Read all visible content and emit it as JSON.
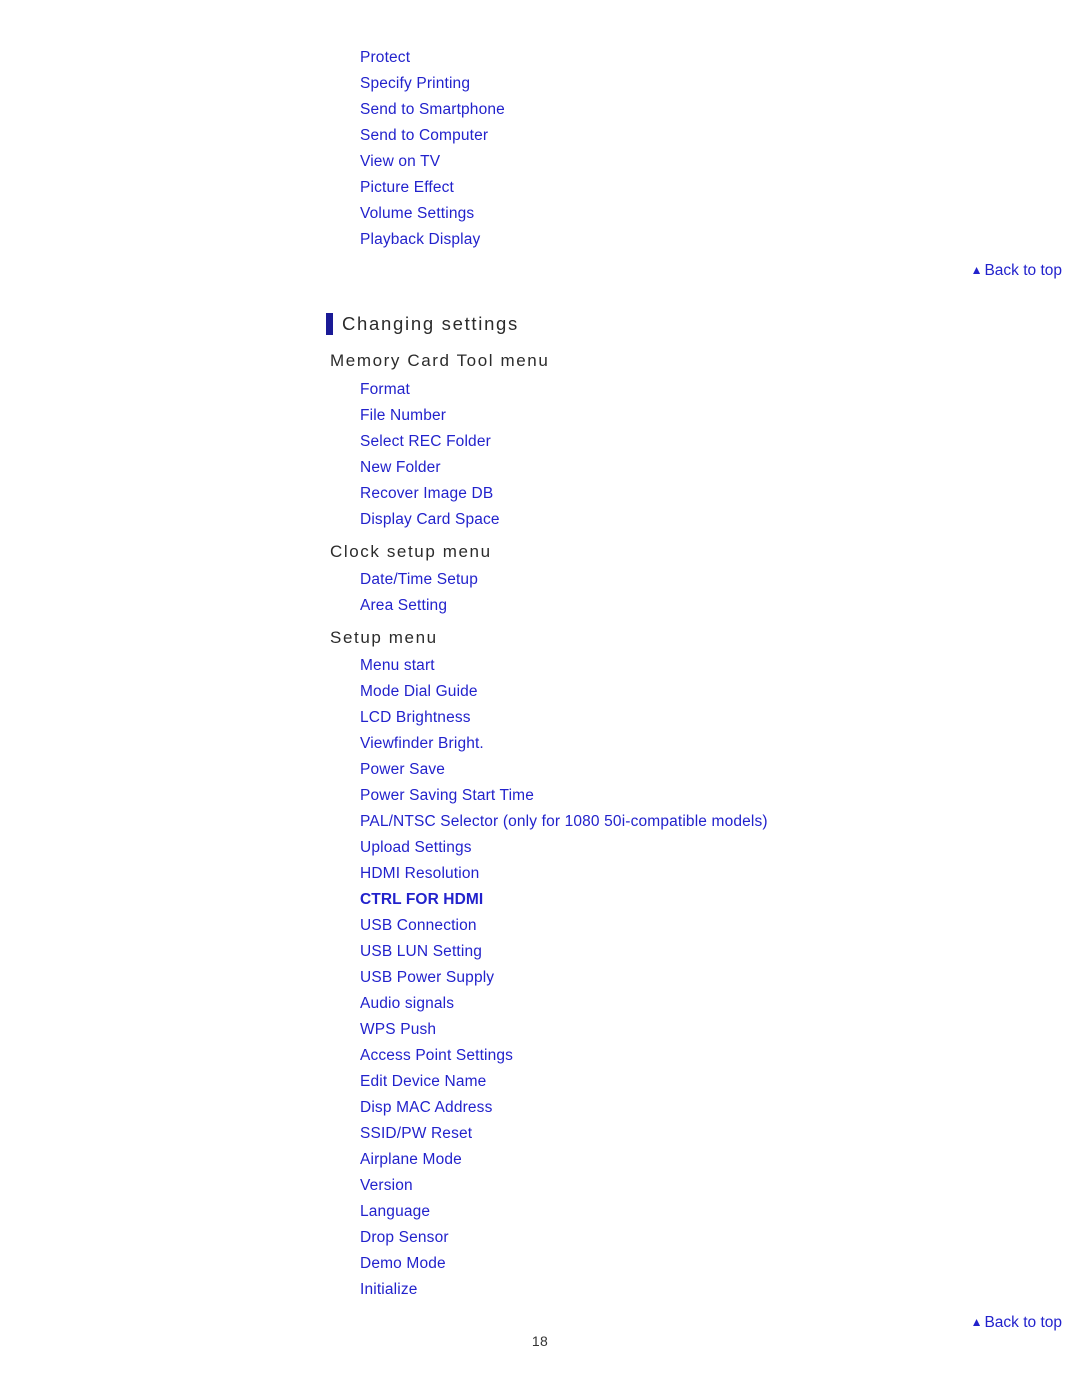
{
  "page": {
    "number": "18",
    "background_color": "#ffffff",
    "link_color": "#2222cc",
    "heading_color": "#2b2b2b",
    "accent_bar_color": "#1a1a96"
  },
  "top_list": {
    "items": [
      "Protect",
      "Specify Printing",
      "Send to Smartphone",
      "Send to Computer",
      "View on TV",
      "Picture Effect",
      "Volume Settings",
      "Playback Display"
    ]
  },
  "back_to_top": {
    "label": "Back to top",
    "icon": "triangle-up-icon",
    "glyph": "▲"
  },
  "section": {
    "title": "Changing settings",
    "groups": [
      {
        "heading": "Memory Card Tool menu",
        "items": [
          {
            "label": "Format",
            "bold": false
          },
          {
            "label": "File Number",
            "bold": false
          },
          {
            "label": "Select REC Folder",
            "bold": false
          },
          {
            "label": "New Folder",
            "bold": false
          },
          {
            "label": "Recover Image DB",
            "bold": false
          },
          {
            "label": "Display Card Space",
            "bold": false
          }
        ]
      },
      {
        "heading": "Clock setup menu",
        "items": [
          {
            "label": "Date/Time Setup",
            "bold": false
          },
          {
            "label": "Area Setting",
            "bold": false
          }
        ]
      },
      {
        "heading": "Setup menu",
        "items": [
          {
            "label": "Menu start",
            "bold": false
          },
          {
            "label": "Mode Dial Guide",
            "bold": false
          },
          {
            "label": "LCD Brightness",
            "bold": false
          },
          {
            "label": "Viewfinder Bright.",
            "bold": false
          },
          {
            "label": "Power Save",
            "bold": false
          },
          {
            "label": "Power Saving Start Time",
            "bold": false
          },
          {
            "label": "PAL/NTSC Selector (only for 1080 50i-compatible models)",
            "bold": false
          },
          {
            "label": "Upload Settings",
            "bold": false
          },
          {
            "label": "HDMI Resolution",
            "bold": false
          },
          {
            "label": "CTRL FOR HDMI",
            "bold": true
          },
          {
            "label": "USB Connection",
            "bold": false
          },
          {
            "label": "USB LUN Setting",
            "bold": false
          },
          {
            "label": "USB Power Supply",
            "bold": false
          },
          {
            "label": "Audio signals",
            "bold": false
          },
          {
            "label": "WPS Push",
            "bold": false
          },
          {
            "label": "Access Point Settings",
            "bold": false
          },
          {
            "label": "Edit Device Name",
            "bold": false
          },
          {
            "label": "Disp MAC Address",
            "bold": false
          },
          {
            "label": "SSID/PW Reset",
            "bold": false
          },
          {
            "label": "Airplane Mode",
            "bold": false
          },
          {
            "label": "Version",
            "bold": false
          },
          {
            "label": "Language",
            "bold": false
          },
          {
            "label": "Drop Sensor",
            "bold": false
          },
          {
            "label": "Demo Mode",
            "bold": false
          },
          {
            "label": "Initialize",
            "bold": false
          }
        ]
      }
    ]
  }
}
